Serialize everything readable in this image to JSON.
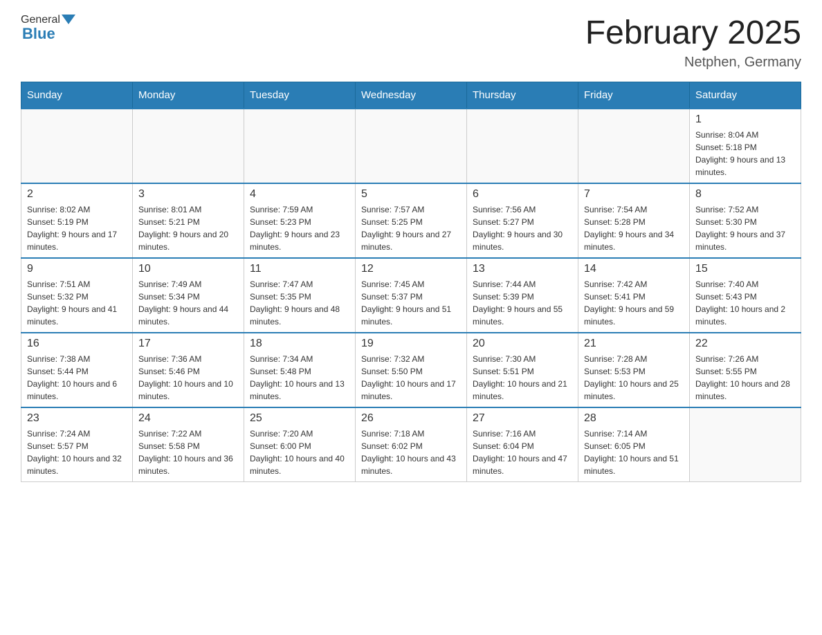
{
  "header": {
    "logo": {
      "general": "General",
      "blue": "Blue",
      "line2": "Blue"
    },
    "title": "February 2025",
    "location": "Netphen, Germany"
  },
  "weekdays": [
    "Sunday",
    "Monday",
    "Tuesday",
    "Wednesday",
    "Thursday",
    "Friday",
    "Saturday"
  ],
  "weeks": [
    [
      {
        "day": "",
        "info": ""
      },
      {
        "day": "",
        "info": ""
      },
      {
        "day": "",
        "info": ""
      },
      {
        "day": "",
        "info": ""
      },
      {
        "day": "",
        "info": ""
      },
      {
        "day": "",
        "info": ""
      },
      {
        "day": "1",
        "info": "Sunrise: 8:04 AM\nSunset: 5:18 PM\nDaylight: 9 hours and 13 minutes."
      }
    ],
    [
      {
        "day": "2",
        "info": "Sunrise: 8:02 AM\nSunset: 5:19 PM\nDaylight: 9 hours and 17 minutes."
      },
      {
        "day": "3",
        "info": "Sunrise: 8:01 AM\nSunset: 5:21 PM\nDaylight: 9 hours and 20 minutes."
      },
      {
        "day": "4",
        "info": "Sunrise: 7:59 AM\nSunset: 5:23 PM\nDaylight: 9 hours and 23 minutes."
      },
      {
        "day": "5",
        "info": "Sunrise: 7:57 AM\nSunset: 5:25 PM\nDaylight: 9 hours and 27 minutes."
      },
      {
        "day": "6",
        "info": "Sunrise: 7:56 AM\nSunset: 5:27 PM\nDaylight: 9 hours and 30 minutes."
      },
      {
        "day": "7",
        "info": "Sunrise: 7:54 AM\nSunset: 5:28 PM\nDaylight: 9 hours and 34 minutes."
      },
      {
        "day": "8",
        "info": "Sunrise: 7:52 AM\nSunset: 5:30 PM\nDaylight: 9 hours and 37 minutes."
      }
    ],
    [
      {
        "day": "9",
        "info": "Sunrise: 7:51 AM\nSunset: 5:32 PM\nDaylight: 9 hours and 41 minutes."
      },
      {
        "day": "10",
        "info": "Sunrise: 7:49 AM\nSunset: 5:34 PM\nDaylight: 9 hours and 44 minutes."
      },
      {
        "day": "11",
        "info": "Sunrise: 7:47 AM\nSunset: 5:35 PM\nDaylight: 9 hours and 48 minutes."
      },
      {
        "day": "12",
        "info": "Sunrise: 7:45 AM\nSunset: 5:37 PM\nDaylight: 9 hours and 51 minutes."
      },
      {
        "day": "13",
        "info": "Sunrise: 7:44 AM\nSunset: 5:39 PM\nDaylight: 9 hours and 55 minutes."
      },
      {
        "day": "14",
        "info": "Sunrise: 7:42 AM\nSunset: 5:41 PM\nDaylight: 9 hours and 59 minutes."
      },
      {
        "day": "15",
        "info": "Sunrise: 7:40 AM\nSunset: 5:43 PM\nDaylight: 10 hours and 2 minutes."
      }
    ],
    [
      {
        "day": "16",
        "info": "Sunrise: 7:38 AM\nSunset: 5:44 PM\nDaylight: 10 hours and 6 minutes."
      },
      {
        "day": "17",
        "info": "Sunrise: 7:36 AM\nSunset: 5:46 PM\nDaylight: 10 hours and 10 minutes."
      },
      {
        "day": "18",
        "info": "Sunrise: 7:34 AM\nSunset: 5:48 PM\nDaylight: 10 hours and 13 minutes."
      },
      {
        "day": "19",
        "info": "Sunrise: 7:32 AM\nSunset: 5:50 PM\nDaylight: 10 hours and 17 minutes."
      },
      {
        "day": "20",
        "info": "Sunrise: 7:30 AM\nSunset: 5:51 PM\nDaylight: 10 hours and 21 minutes."
      },
      {
        "day": "21",
        "info": "Sunrise: 7:28 AM\nSunset: 5:53 PM\nDaylight: 10 hours and 25 minutes."
      },
      {
        "day": "22",
        "info": "Sunrise: 7:26 AM\nSunset: 5:55 PM\nDaylight: 10 hours and 28 minutes."
      }
    ],
    [
      {
        "day": "23",
        "info": "Sunrise: 7:24 AM\nSunset: 5:57 PM\nDaylight: 10 hours and 32 minutes."
      },
      {
        "day": "24",
        "info": "Sunrise: 7:22 AM\nSunset: 5:58 PM\nDaylight: 10 hours and 36 minutes."
      },
      {
        "day": "25",
        "info": "Sunrise: 7:20 AM\nSunset: 6:00 PM\nDaylight: 10 hours and 40 minutes."
      },
      {
        "day": "26",
        "info": "Sunrise: 7:18 AM\nSunset: 6:02 PM\nDaylight: 10 hours and 43 minutes."
      },
      {
        "day": "27",
        "info": "Sunrise: 7:16 AM\nSunset: 6:04 PM\nDaylight: 10 hours and 47 minutes."
      },
      {
        "day": "28",
        "info": "Sunrise: 7:14 AM\nSunset: 6:05 PM\nDaylight: 10 hours and 51 minutes."
      },
      {
        "day": "",
        "info": ""
      }
    ]
  ]
}
